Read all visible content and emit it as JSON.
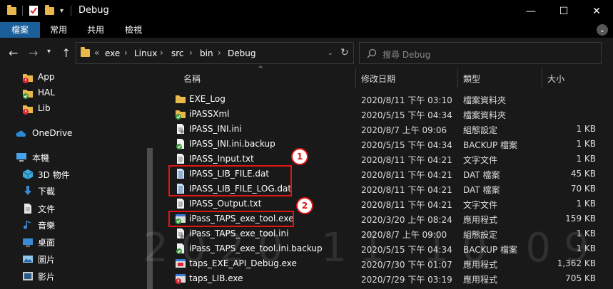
{
  "window": {
    "title": "Debug"
  },
  "ribbon": {
    "tabs": [
      "檔案",
      "常用",
      "共用",
      "檢視"
    ]
  },
  "address": {
    "overflow": "«",
    "parts": [
      "exe",
      "Linux",
      "src",
      "bin",
      "Debug"
    ]
  },
  "search": {
    "placeholder": "搜尋 Debug"
  },
  "sidebar": {
    "items": [
      {
        "label": "App",
        "icon": "folder-error-icon"
      },
      {
        "label": "HAL",
        "icon": "folder-sync-icon"
      },
      {
        "label": "Lib",
        "icon": "folder-error-icon"
      },
      {
        "label": "OneDrive",
        "icon": "cloud-icon"
      },
      {
        "label": "本機",
        "icon": "computer-icon"
      },
      {
        "label": "3D 物件",
        "icon": "cube-icon"
      },
      {
        "label": "下載",
        "icon": "download-icon"
      },
      {
        "label": "文件",
        "icon": "document-icon"
      },
      {
        "label": "音樂",
        "icon": "music-icon"
      },
      {
        "label": "桌面",
        "icon": "desktop-icon"
      },
      {
        "label": "圖片",
        "icon": "picture-icon"
      },
      {
        "label": "影片",
        "icon": "video-icon"
      }
    ]
  },
  "columns": {
    "name": "名稱",
    "date": "修改日期",
    "type": "類型",
    "size": "大小"
  },
  "files": [
    {
      "name": "EXE_Log",
      "date": "2020/8/11 下午 03:10",
      "type": "檔案資料夾",
      "size": "",
      "icon": "folder-icon"
    },
    {
      "name": "iPASSXml",
      "date": "2020/5/15 下午 04:34",
      "type": "檔案資料夾",
      "size": "",
      "icon": "folder-sync-icon"
    },
    {
      "name": "IPASS_INI.ini",
      "date": "2020/8/7 上午 09:06",
      "type": "組態設定",
      "size": "1 KB",
      "icon": "ini-file-icon"
    },
    {
      "name": "IPASS_INI.ini.backup",
      "date": "2020/5/15 下午 04:34",
      "type": "BACKUP 檔案",
      "size": "1 KB",
      "icon": "file-sync-icon"
    },
    {
      "name": "IPASS_Input.txt",
      "date": "2020/8/11 下午 04:21",
      "type": "文字文件",
      "size": "1 KB",
      "icon": "text-file-icon"
    },
    {
      "name": "IPASS_LIB_FILE.dat",
      "date": "2020/8/11 下午 04:21",
      "type": "DAT 檔案",
      "size": "45 KB",
      "icon": "dat-file-icon"
    },
    {
      "name": "IPASS_LIB_FILE_LOG.dat",
      "date": "2020/8/11 下午 04:21",
      "type": "DAT 檔案",
      "size": "70 KB",
      "icon": "dat-file-icon"
    },
    {
      "name": "IPASS_Output.txt",
      "date": "2020/8/11 下午 04:21",
      "type": "文字文件",
      "size": "1 KB",
      "icon": "text-file-icon"
    },
    {
      "name": "iPass_TAPS_exe_tool.exe",
      "date": "2020/3/20 上午 08:24",
      "type": "應用程式",
      "size": "159 KB",
      "icon": "exe-sync-icon"
    },
    {
      "name": "iPass_TAPS_exe_tool.ini",
      "date": "2020/8/7 上午 09:00",
      "type": "組態設定",
      "size": "1 KB",
      "icon": "ini-file-icon"
    },
    {
      "name": "iPass_TAPS_exe_tool.ini.backup",
      "date": "2020/5/15 下午 04:34",
      "type": "BACKUP 檔案",
      "size": "1 KB",
      "icon": "file-sync-icon"
    },
    {
      "name": "taps_EXE_API_Debug.exe",
      "date": "2020/7/30 下午 01:07",
      "type": "應用程式",
      "size": "1,362 KB",
      "icon": "exe-icon"
    },
    {
      "name": "taps_LIB.exe",
      "date": "2020/7/29 下午 03:19",
      "type": "應用程式",
      "size": "705 KB",
      "icon": "exe-error-icon"
    }
  ],
  "annotations": {
    "badge1": "1",
    "badge2": "2"
  },
  "watermark": "2020 11 10 09",
  "colors": {
    "accent": "#1a5f9a",
    "highlight_box": "#e01515",
    "folder": "#e8b94a"
  }
}
